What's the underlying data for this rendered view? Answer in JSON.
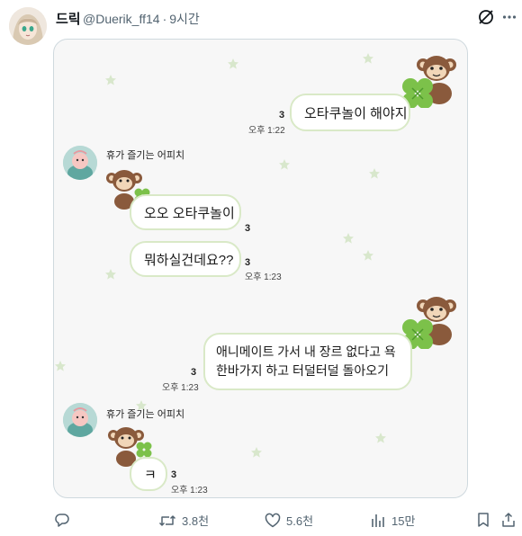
{
  "post": {
    "author_name": "드릭",
    "handle": "@Duerik_ff14",
    "separator": "·",
    "time_ago": "9시간"
  },
  "chat": {
    "sender_name": "휴가 즐기는 어피치",
    "messages": [
      {
        "side": "right",
        "text": "오타쿠놀이 해야지",
        "read": "3",
        "time": "오후 1:22"
      },
      {
        "side": "left",
        "text": "오오 오타쿠놀이",
        "read": "3",
        "time": ""
      },
      {
        "side": "left",
        "text": "뭐하실건데요??",
        "read": "3",
        "time": "오후 1:23"
      },
      {
        "side": "right",
        "line1": "애니메이트 가서 내 장르 없다고 욕",
        "line2": "한바가지 하고 터덜터덜 돌아오기",
        "read": "3",
        "time": "오후 1:23"
      },
      {
        "side": "left",
        "text": "ㅋ",
        "read": "3",
        "time": "오후 1:23"
      }
    ]
  },
  "actions": {
    "reply_count": "",
    "retweet_count": "3.8천",
    "like_count": "5.6천",
    "view_count": "15만"
  },
  "colors": {
    "bubble_border": "#d9e9c7",
    "clover": "#7cc14a",
    "monkey_brown": "#8a5a3c"
  }
}
